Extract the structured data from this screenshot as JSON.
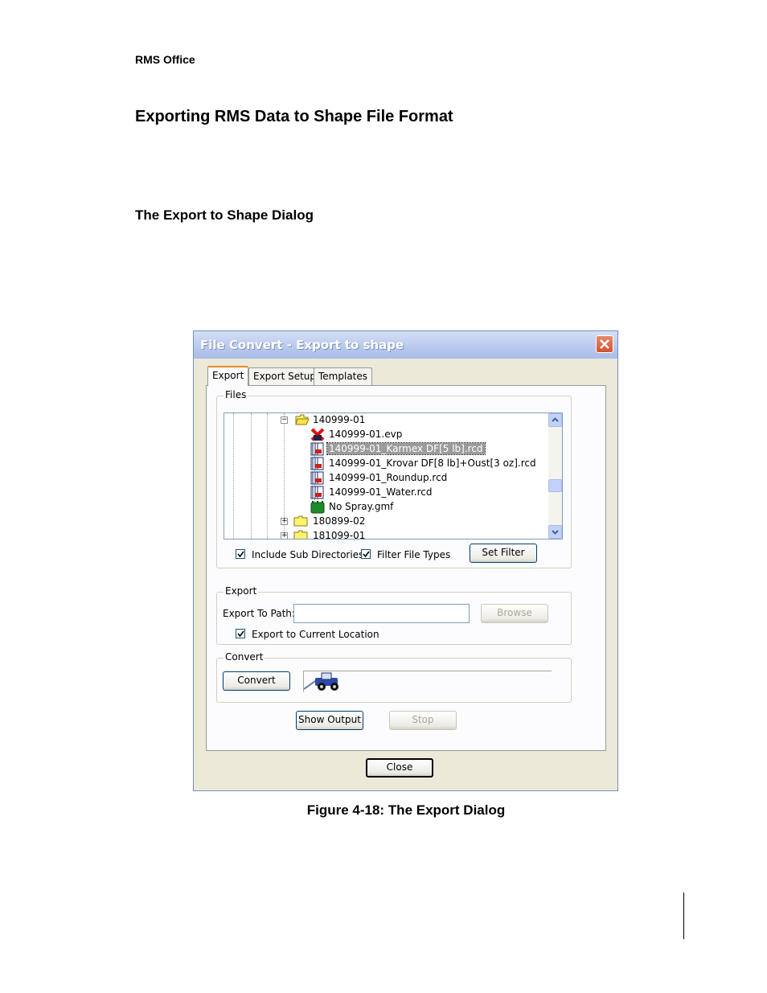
{
  "page": {
    "running_head": "RMS Office",
    "heading": "Exporting RMS Data to Shape File Format",
    "subheading": "The Export to Shape Dialog",
    "caption": "Figure 4-18: The Export Dialog"
  },
  "dialog": {
    "title": "File Convert - Export to shape",
    "tabs": [
      {
        "label": "Export",
        "active": true
      },
      {
        "label": "Export Setup",
        "active": false
      },
      {
        "label": "Templates",
        "active": false
      }
    ],
    "files_group": {
      "label": "Files",
      "tree": [
        {
          "label": "140999-01",
          "icon": "folder-open-icon",
          "expander": "−"
        },
        {
          "label": "140999-01.evp",
          "icon": "evp-file-icon"
        },
        {
          "label": "140999-01_Karmex DF[5 lb].rcd",
          "icon": "rcd-file-icon",
          "selected": true
        },
        {
          "label": "140999-01_Krovar DF[8 lb]+Oust[3 oz].rcd",
          "icon": "rcd-file-icon"
        },
        {
          "label": "140999-01_Roundup.rcd",
          "icon": "rcd-file-icon"
        },
        {
          "label": "140999-01_Water.rcd",
          "icon": "rcd-file-icon"
        },
        {
          "label": "No Spray.gmf",
          "icon": "gmf-file-icon"
        },
        {
          "label": "180899-02",
          "icon": "folder-icon",
          "expander": "+"
        },
        {
          "label": "181099-01",
          "icon": "folder-icon",
          "expander": "+"
        }
      ],
      "include_sub_directories": {
        "label": "Include Sub Directories",
        "checked": true
      },
      "filter_file_types": {
        "label": "Filter File Types",
        "checked": true
      },
      "set_filter_button": "Set Filter"
    },
    "export_group": {
      "label": "Export",
      "path_label": "Export To Path:",
      "path_value": "",
      "browse_button": "Browse",
      "export_current": {
        "label": "Export to Current Location",
        "checked": true
      }
    },
    "convert_group": {
      "label": "Convert",
      "convert_button": "Convert",
      "progress_icon": "tractor-icon"
    },
    "show_output_button": "Show Output",
    "stop_button": "Stop",
    "close_button": "Close"
  }
}
